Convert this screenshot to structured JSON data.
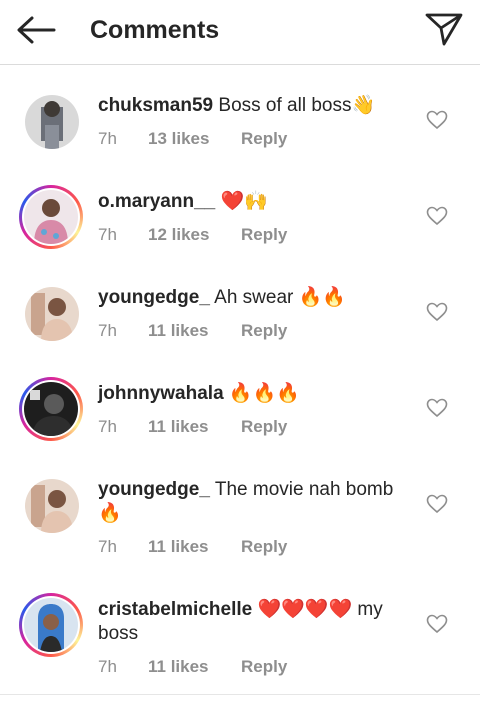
{
  "header": {
    "title": "Comments",
    "back_icon": "arrow-left-icon",
    "send_icon": "paper-plane-icon"
  },
  "comments": [
    {
      "username": "chuksman59",
      "text": "Boss of all boss👋",
      "time": "7h",
      "likes": "13 likes",
      "reply": "Reply",
      "story_ring": false,
      "avatar_color": "#6b6f78"
    },
    {
      "username": "o.maryann__",
      "text": "❤️🙌",
      "time": "7h",
      "likes": "12 likes",
      "reply": "Reply",
      "story_ring": true,
      "avatar_color": "#c9b7c4"
    },
    {
      "username": "youngedge_",
      "text": "Ah swear 🔥🔥",
      "time": "7h",
      "likes": "11 likes",
      "reply": "Reply",
      "story_ring": false,
      "avatar_color": "#b79b8d"
    },
    {
      "username": "johnnywahala",
      "text": "🔥🔥🔥",
      "time": "7h",
      "likes": "11 likes",
      "reply": "Reply",
      "story_ring": true,
      "avatar_color": "#3a3a3a"
    },
    {
      "username": "youngedge_",
      "text": "The movie nah bomb🔥",
      "time": "7h",
      "likes": "11 likes",
      "reply": "Reply",
      "story_ring": false,
      "avatar_color": "#b79b8d"
    },
    {
      "username": "cristabelmichelle",
      "text": "❤️❤️❤️❤️ my boss",
      "time": "7h",
      "likes": "11 likes",
      "reply": "Reply",
      "story_ring": true,
      "avatar_color": "#3a7ac9"
    }
  ]
}
